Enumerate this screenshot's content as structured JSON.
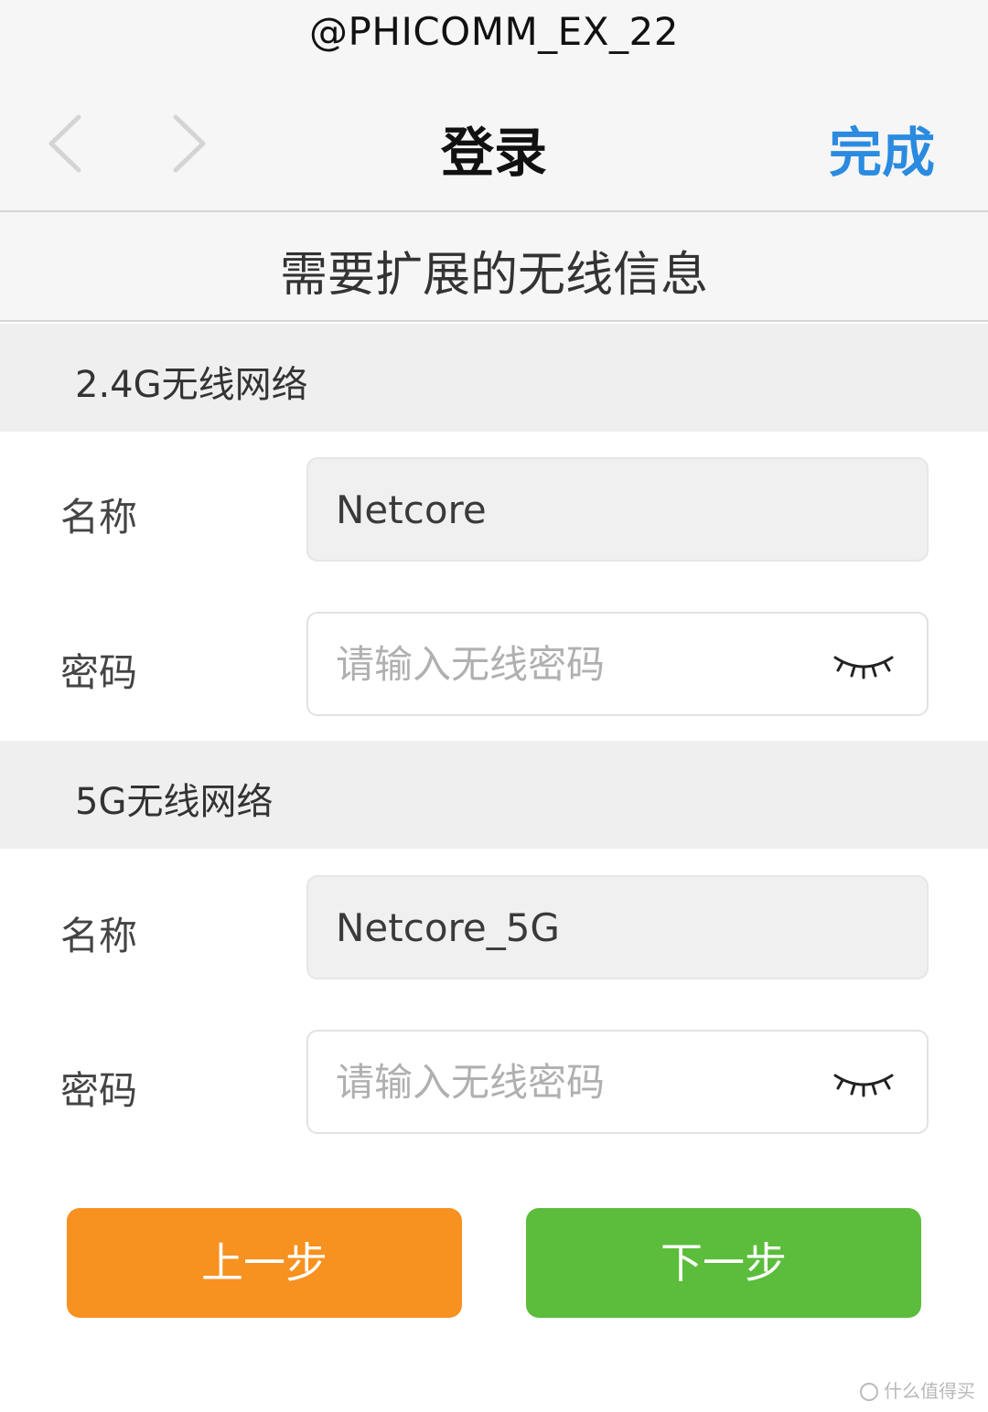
{
  "header": {
    "host": "@PHICOMM_EX_22",
    "title": "登录",
    "done_label": "完成",
    "back_icon": "chevron-left-icon",
    "forward_icon": "chevron-right-icon"
  },
  "section_title": "需要扩展的无线信息",
  "networks": [
    {
      "header": "2.4G无线网络",
      "name_label": "名称",
      "name_value": "Netcore",
      "password_label": "密码",
      "password_placeholder": "请输入无线密码",
      "toggle_icon": "eye-closed-icon"
    },
    {
      "header": "5G无线网络",
      "name_label": "名称",
      "name_value": "Netcore_5G",
      "password_label": "密码",
      "password_placeholder": "请输入无线密码",
      "toggle_icon": "eye-closed-icon"
    }
  ],
  "buttons": {
    "prev_label": "上一步",
    "next_label": "下一步"
  },
  "watermark": "什么值得买",
  "colors": {
    "accent_blue": "#2a8be0",
    "prev_orange": "#f7911f",
    "next_green": "#5bbd3b"
  }
}
